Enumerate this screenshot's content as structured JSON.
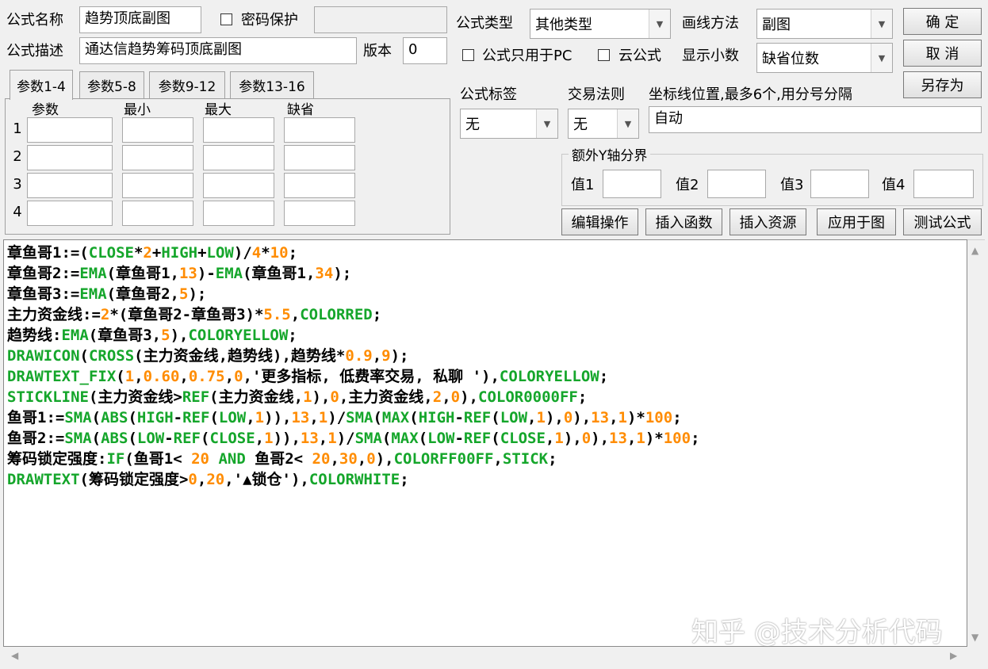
{
  "header": {
    "name_label": "公式名称",
    "name_value": "趋势顶底副图",
    "password_label": "密码保护",
    "password_value": "",
    "desc_label": "公式描述",
    "desc_value": "通达信趋势筹码顶底副图",
    "version_label": "版本",
    "version_value": "0"
  },
  "formula_type": {
    "label": "公式类型",
    "value": "其他类型",
    "pc_only_label": "公式只用于PC",
    "cloud_label": "云公式"
  },
  "draw_method": {
    "label": "画线方法",
    "value": "副图",
    "decimal_label": "显示小数",
    "decimal_value": "缺省位数"
  },
  "buttons": {
    "ok": "确  定",
    "cancel": "取  消",
    "save_as": "另存为",
    "edit_ops": "编辑操作",
    "insert_func": "插入函数",
    "insert_res": "插入资源",
    "apply_chart": "应用于图",
    "test_formula": "测试公式"
  },
  "params": {
    "tabs": [
      "参数1-4",
      "参数5-8",
      "参数9-12",
      "参数13-16"
    ],
    "columns": [
      "参数",
      "最小",
      "最大",
      "缺省"
    ],
    "rows": [
      "1",
      "2",
      "3",
      "4"
    ]
  },
  "tags": {
    "formula_tag_label": "公式标签",
    "formula_tag_value": "无",
    "trade_rule_label": "交易法则",
    "trade_rule_value": "无",
    "axis_label": "坐标线位置,最多6个,用分号分隔",
    "axis_value": "自动"
  },
  "extra_y": {
    "legend": "额外Y轴分界",
    "labels": [
      "值1",
      "值2",
      "值3",
      "值4"
    ]
  },
  "code": {
    "lines": [
      [
        [
          "t",
          "章鱼哥1:=("
        ],
        [
          "k",
          "CLOSE"
        ],
        [
          "t",
          "*"
        ],
        [
          "n",
          "2"
        ],
        [
          "t",
          "+"
        ],
        [
          "k",
          "HIGH"
        ],
        [
          "t",
          "+"
        ],
        [
          "k",
          "LOW"
        ],
        [
          "t",
          ")/"
        ],
        [
          "n",
          "4"
        ],
        [
          "t",
          "*"
        ],
        [
          "n",
          "10"
        ],
        [
          "t",
          ";"
        ]
      ],
      [
        [
          "t",
          "章鱼哥2:="
        ],
        [
          "k",
          "EMA"
        ],
        [
          "t",
          "(章鱼哥1,"
        ],
        [
          "n",
          "13"
        ],
        [
          "t",
          ")-"
        ],
        [
          "k",
          "EMA"
        ],
        [
          "t",
          "(章鱼哥1,"
        ],
        [
          "n",
          "34"
        ],
        [
          "t",
          ");"
        ]
      ],
      [
        [
          "t",
          "章鱼哥3:="
        ],
        [
          "k",
          "EMA"
        ],
        [
          "t",
          "(章鱼哥2,"
        ],
        [
          "n",
          "5"
        ],
        [
          "t",
          ");"
        ]
      ],
      [
        [
          "t",
          "主力资金线:="
        ],
        [
          "n",
          "2"
        ],
        [
          "t",
          "*(章鱼哥2-章鱼哥3)*"
        ],
        [
          "n",
          "5.5"
        ],
        [
          "t",
          ","
        ],
        [
          "k",
          "COLORRED"
        ],
        [
          "t",
          ";"
        ]
      ],
      [
        [
          "t",
          "趋势线:"
        ],
        [
          "k",
          "EMA"
        ],
        [
          "t",
          "(章鱼哥3,"
        ],
        [
          "n",
          "5"
        ],
        [
          "t",
          "),"
        ],
        [
          "k",
          "COLORYELLOW"
        ],
        [
          "t",
          ";"
        ]
      ],
      [
        [
          "k",
          "DRAWICON"
        ],
        [
          "t",
          "("
        ],
        [
          "k",
          "CROSS"
        ],
        [
          "t",
          "(主力资金线,趋势线),趋势线*"
        ],
        [
          "n",
          "0.9"
        ],
        [
          "t",
          ","
        ],
        [
          "n",
          "9"
        ],
        [
          "t",
          ");"
        ]
      ],
      [
        [
          "k",
          "DRAWTEXT_FIX"
        ],
        [
          "t",
          "("
        ],
        [
          "n",
          "1"
        ],
        [
          "t",
          ","
        ],
        [
          "n",
          "0.60"
        ],
        [
          "t",
          ","
        ],
        [
          "n",
          "0.75"
        ],
        [
          "t",
          ","
        ],
        [
          "n",
          "0"
        ],
        [
          "t",
          ",'更多指标, 低费率交易, 私聊 '),"
        ],
        [
          "k",
          "COLORYELLOW"
        ],
        [
          "t",
          ";"
        ]
      ],
      [
        [
          "k",
          "STICKLINE"
        ],
        [
          "t",
          "(主力资金线>"
        ],
        [
          "k",
          "REF"
        ],
        [
          "t",
          "(主力资金线,"
        ],
        [
          "n",
          "1"
        ],
        [
          "t",
          "),"
        ],
        [
          "n",
          "0"
        ],
        [
          "t",
          ",主力资金线,"
        ],
        [
          "n",
          "2"
        ],
        [
          "t",
          ","
        ],
        [
          "n",
          "0"
        ],
        [
          "t",
          "),"
        ],
        [
          "k",
          "COLOR0000FF"
        ],
        [
          "t",
          ";"
        ]
      ],
      [
        [
          "t",
          "鱼哥1:="
        ],
        [
          "k",
          "SMA"
        ],
        [
          "t",
          "("
        ],
        [
          "k",
          "ABS"
        ],
        [
          "t",
          "("
        ],
        [
          "k",
          "HIGH"
        ],
        [
          "t",
          "-"
        ],
        [
          "k",
          "REF"
        ],
        [
          "t",
          "("
        ],
        [
          "k",
          "LOW"
        ],
        [
          "t",
          ","
        ],
        [
          "n",
          "1"
        ],
        [
          "t",
          ")),"
        ],
        [
          "n",
          "13"
        ],
        [
          "t",
          ","
        ],
        [
          "n",
          "1"
        ],
        [
          "t",
          ")/"
        ],
        [
          "k",
          "SMA"
        ],
        [
          "t",
          "("
        ],
        [
          "k",
          "MAX"
        ],
        [
          "t",
          "("
        ],
        [
          "k",
          "HIGH"
        ],
        [
          "t",
          "-"
        ],
        [
          "k",
          "REF"
        ],
        [
          "t",
          "("
        ],
        [
          "k",
          "LOW"
        ],
        [
          "t",
          ","
        ],
        [
          "n",
          "1"
        ],
        [
          "t",
          "),"
        ],
        [
          "n",
          "0"
        ],
        [
          "t",
          "),"
        ],
        [
          "n",
          "13"
        ],
        [
          "t",
          ","
        ],
        [
          "n",
          "1"
        ],
        [
          "t",
          ")*"
        ],
        [
          "n",
          "100"
        ],
        [
          "t",
          ";"
        ]
      ],
      [
        [
          "t",
          "鱼哥2:="
        ],
        [
          "k",
          "SMA"
        ],
        [
          "t",
          "("
        ],
        [
          "k",
          "ABS"
        ],
        [
          "t",
          "("
        ],
        [
          "k",
          "LOW"
        ],
        [
          "t",
          "-"
        ],
        [
          "k",
          "REF"
        ],
        [
          "t",
          "("
        ],
        [
          "k",
          "CLOSE"
        ],
        [
          "t",
          ","
        ],
        [
          "n",
          "1"
        ],
        [
          "t",
          ")),"
        ],
        [
          "n",
          "13"
        ],
        [
          "t",
          ","
        ],
        [
          "n",
          "1"
        ],
        [
          "t",
          ")/"
        ],
        [
          "k",
          "SMA"
        ],
        [
          "t",
          "("
        ],
        [
          "k",
          "MAX"
        ],
        [
          "t",
          "("
        ],
        [
          "k",
          "LOW"
        ],
        [
          "t",
          "-"
        ],
        [
          "k",
          "REF"
        ],
        [
          "t",
          "("
        ],
        [
          "k",
          "CLOSE"
        ],
        [
          "t",
          ","
        ],
        [
          "n",
          "1"
        ],
        [
          "t",
          "),"
        ],
        [
          "n",
          "0"
        ],
        [
          "t",
          "),"
        ],
        [
          "n",
          "13"
        ],
        [
          "t",
          ","
        ],
        [
          "n",
          "1"
        ],
        [
          "t",
          ")*"
        ],
        [
          "n",
          "100"
        ],
        [
          "t",
          ";"
        ]
      ],
      [
        [
          "t",
          "筹码锁定强度:"
        ],
        [
          "k",
          "IF"
        ],
        [
          "t",
          "(鱼哥1< "
        ],
        [
          "n",
          "20"
        ],
        [
          "t",
          " "
        ],
        [
          "k",
          "AND"
        ],
        [
          "t",
          " 鱼哥2< "
        ],
        [
          "n",
          "20"
        ],
        [
          "t",
          ","
        ],
        [
          "n",
          "30"
        ],
        [
          "t",
          ","
        ],
        [
          "n",
          "0"
        ],
        [
          "t",
          "),"
        ],
        [
          "k",
          "COLORFF00FF"
        ],
        [
          "t",
          ","
        ],
        [
          "k",
          "STICK"
        ],
        [
          "t",
          ";"
        ]
      ],
      [
        [
          "k",
          "DRAWTEXT"
        ],
        [
          "t",
          "(筹码锁定强度>"
        ],
        [
          "n",
          "0"
        ],
        [
          "t",
          ","
        ],
        [
          "n",
          "20"
        ],
        [
          "t",
          ",'▲锁仓'),"
        ],
        [
          "k",
          "COLORWHITE"
        ],
        [
          "t",
          ";"
        ]
      ]
    ]
  },
  "watermark": "知乎 @技术分析代码"
}
